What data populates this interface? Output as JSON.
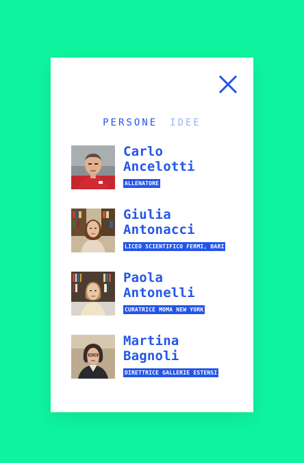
{
  "colors": {
    "background": "#0ff59f",
    "accent": "#2455e8",
    "tab_inactive": "#9db3f5",
    "card": "#ffffff"
  },
  "close": {
    "icon": "close-icon"
  },
  "tabs": [
    {
      "label": "PERSONE",
      "active": true
    },
    {
      "label": "IDEE",
      "active": false
    }
  ],
  "people": [
    {
      "first_name": "Carlo",
      "last_name": "Ancelotti",
      "role": "ALLENATORE",
      "photo": "portrait-photo"
    },
    {
      "first_name": "Giulia",
      "last_name": "Antonacci",
      "role": "LICEO SCIENTIFICO FERMI, BARI",
      "photo": "portrait-photo"
    },
    {
      "first_name": "Paola",
      "last_name": "Antonelli",
      "role": "CURATRICE MOMA NEW YORK",
      "photo": "portrait-photo"
    },
    {
      "first_name": "Martina",
      "last_name": "Bagnoli",
      "role": "DIRETTRICE GALLERIE ESTENSI",
      "photo": "portrait-photo"
    }
  ]
}
